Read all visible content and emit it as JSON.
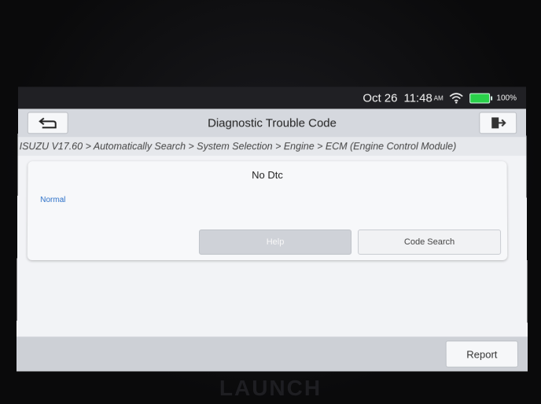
{
  "statusbar": {
    "date": "Oct 26",
    "time": "11:48",
    "ampm": "AM",
    "battery": "100%",
    "battery_color": "#2ad14a"
  },
  "titlebar": {
    "title": "Diagnostic Trouble Code",
    "back_icon": "back-arrow-icon",
    "exit_icon": "exit-icon"
  },
  "breadcrumb": "ISUZU V17.60 > Automatically Search > System Selection > Engine > ECM (Engine Control Module)",
  "card": {
    "heading": "No Dtc",
    "status": "Normal",
    "help_label": "Help",
    "code_search_label": "Code Search"
  },
  "bottombar": {
    "report_label": "Report"
  },
  "device_brand": "LAUNCH"
}
